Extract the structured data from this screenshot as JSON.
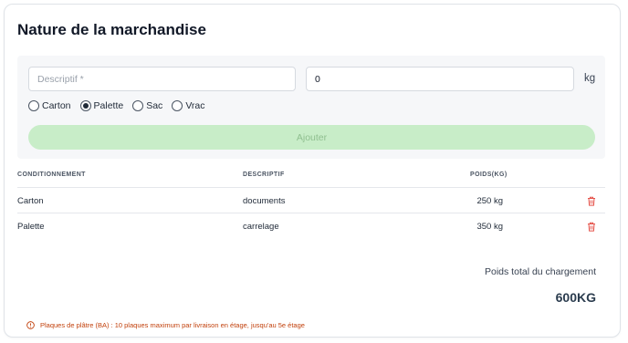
{
  "section": {
    "title": "Nature de la marchandise"
  },
  "form": {
    "description_placeholder": "Descriptif *",
    "weight_value": "0",
    "unit": "kg",
    "packaging_options": [
      {
        "label": "Carton",
        "checked": false
      },
      {
        "label": "Palette",
        "checked": true
      },
      {
        "label": "Sac",
        "checked": false
      },
      {
        "label": "Vrac",
        "checked": false
      }
    ],
    "add_button_label": "Ajouter"
  },
  "table": {
    "headers": {
      "packaging": "CONDITIONNEMENT",
      "description": "DESCRIPTIF",
      "weight": "POIDS(KG)"
    },
    "rows": [
      {
        "packaging": "Carton",
        "description": "documents",
        "weight": "250 kg"
      },
      {
        "packaging": "Palette",
        "description": "carrelage",
        "weight": "350 kg"
      }
    ]
  },
  "summary": {
    "total_label": "Poids total du chargement",
    "total_value": "600KG"
  },
  "warning": {
    "text": "Plaques de plâtre (BA) : 10 plaques maximum par livraison en étage, jusqu'au 5e étage"
  },
  "colors": {
    "accent_green": "#c8edc8",
    "delete_red": "#e5534b",
    "warning_orange": "#c2410c",
    "total_color": "#2b3c4e"
  },
  "icons": {
    "delete": "trash-icon",
    "warning": "info-circle-icon"
  }
}
